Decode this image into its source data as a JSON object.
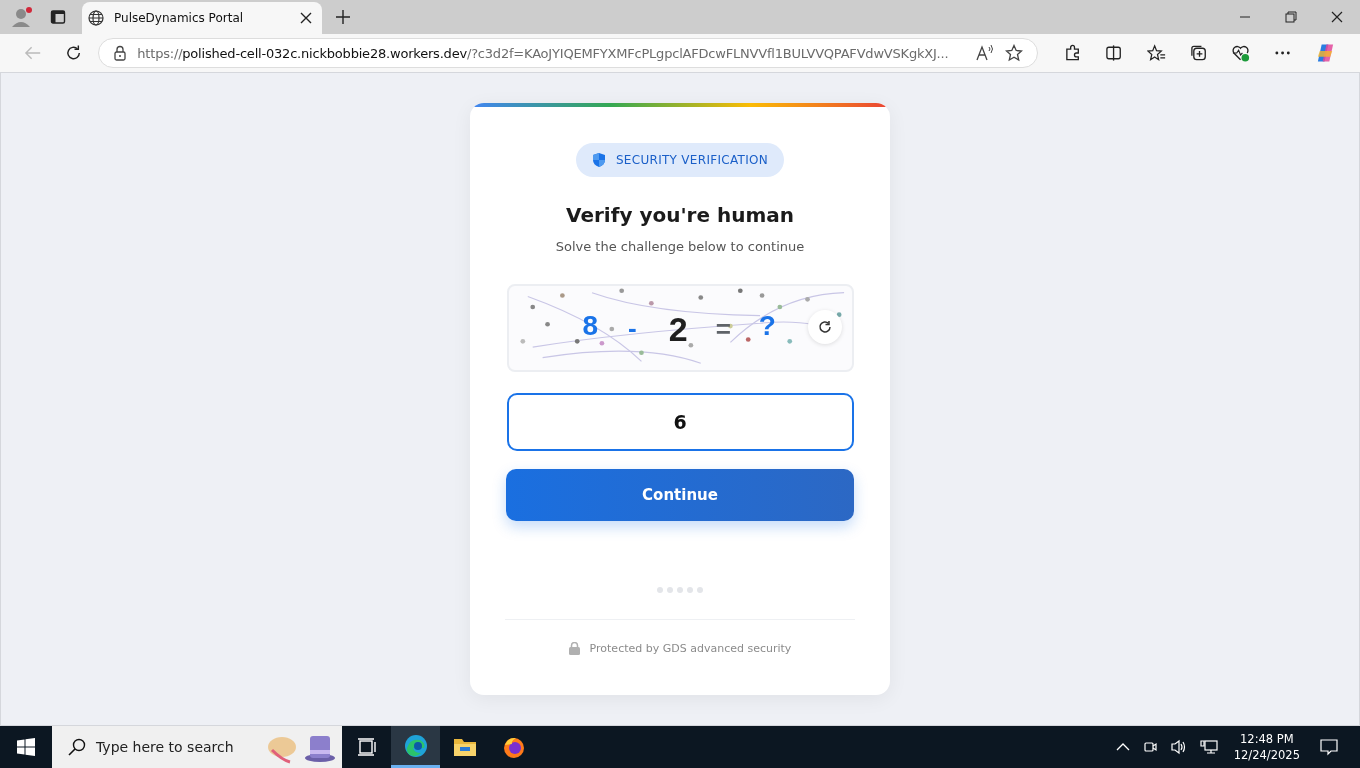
{
  "browser": {
    "tab_title": "PulseDynamics Portal",
    "url": {
      "scheme": "https://",
      "host": "polished-cell-032c.nickbobbie28.workers.dev",
      "rest": "/?c3d2f=KAoJYIQEMFYXMFcPLgpclAFDcwFLNVVfl1BULVVQPAFVdwVSKgkXJ..."
    }
  },
  "card": {
    "badge": "SECURITY VERIFICATION",
    "title": "Verify you're human",
    "subtitle": "Solve the challenge below to continue",
    "captcha": {
      "tokens": [
        {
          "text": "8",
          "color": "#1a73e8"
        },
        {
          "text": "-",
          "color": "#1a73e8"
        },
        {
          "text": "2",
          "color": "#1f1f1f"
        },
        {
          "text": "=",
          "color": "#5f6368"
        },
        {
          "text": "?",
          "color": "#1a73e8"
        }
      ]
    },
    "answer": {
      "value": "6"
    },
    "button": "Continue",
    "footer": "Protected by GDS advanced security"
  },
  "taskbar": {
    "search_placeholder": "Type here to search",
    "apps": [
      {
        "kind": "taskview",
        "selected": false
      },
      {
        "kind": "edge",
        "selected": true
      },
      {
        "kind": "folder",
        "selected": false
      },
      {
        "kind": "firefox",
        "selected": false
      }
    ],
    "time": "12:48 PM",
    "date": "12/24/2025"
  }
}
